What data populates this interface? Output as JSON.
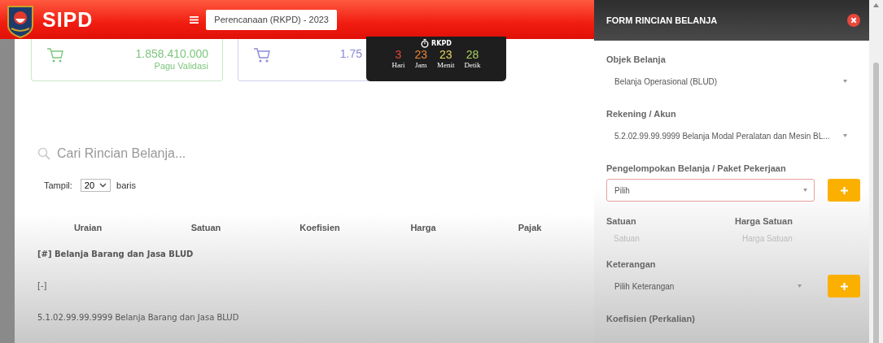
{
  "header": {
    "app_name": "SIPD",
    "context": "Perencanaan (RKPD) - 2023"
  },
  "cards": [
    {
      "amount": "1.858.410.000",
      "label": "Pagu Validasi",
      "color": "#7cc67c"
    },
    {
      "amount": "1.75",
      "color": "#8a8ad8"
    }
  ],
  "countdown": {
    "title": "RKPD",
    "units": [
      {
        "value": "3",
        "label": "Hari",
        "color": "#e0473f"
      },
      {
        "value": "23",
        "label": "Jam",
        "color": "#e8863a"
      },
      {
        "value": "23",
        "label": "Menit",
        "color": "#e6d45a"
      },
      {
        "value": "28",
        "label": "Detik",
        "color": "#a8d060"
      }
    ]
  },
  "search": {
    "placeholder": "Cari Rincian Belanja..."
  },
  "page_size": {
    "label": "Tampil:",
    "value": "20",
    "suffix": "baris"
  },
  "table": {
    "columns": [
      "Uraian",
      "Satuan",
      "Koefisien",
      "Harga",
      "Pajak"
    ],
    "rows": [
      {
        "kind": "group",
        "text": "[#] Belanja Barang dan Jasa BLUD"
      },
      {
        "kind": "item",
        "text": "[-]"
      },
      {
        "kind": "item",
        "text": "5.1.02.99.99.9999 Belanja Barang dan Jasa BLUD"
      }
    ]
  },
  "form": {
    "title": "FORM RINCIAN BELANJA",
    "fields": [
      {
        "kind": "select",
        "label": "Objek Belanja",
        "value": "Belanja Operasional (BLUD)",
        "error": false,
        "add_button": false
      },
      {
        "kind": "select",
        "label": "Rekening / Akun",
        "value": "5.2.02.99.99.9999 Belanja Modal Peralatan dan Mesin BL...",
        "error": false,
        "add_button": false
      },
      {
        "kind": "select",
        "label": "Pengelompokan Belanja / Paket Pekerjaan",
        "value": "Pilih",
        "error": true,
        "add_button": true
      },
      {
        "kind": "pair",
        "items": [
          {
            "label": "Satuan",
            "placeholder": "Satuan"
          },
          {
            "label": "Harga Satuan",
            "placeholder": "Harga Satuan"
          }
        ]
      },
      {
        "kind": "select",
        "label": "Keterangan",
        "value": "Pilih Keterangan",
        "error": false,
        "add_button": true
      },
      {
        "kind": "label",
        "label": "Koefisien (Perkalian)"
      }
    ]
  }
}
